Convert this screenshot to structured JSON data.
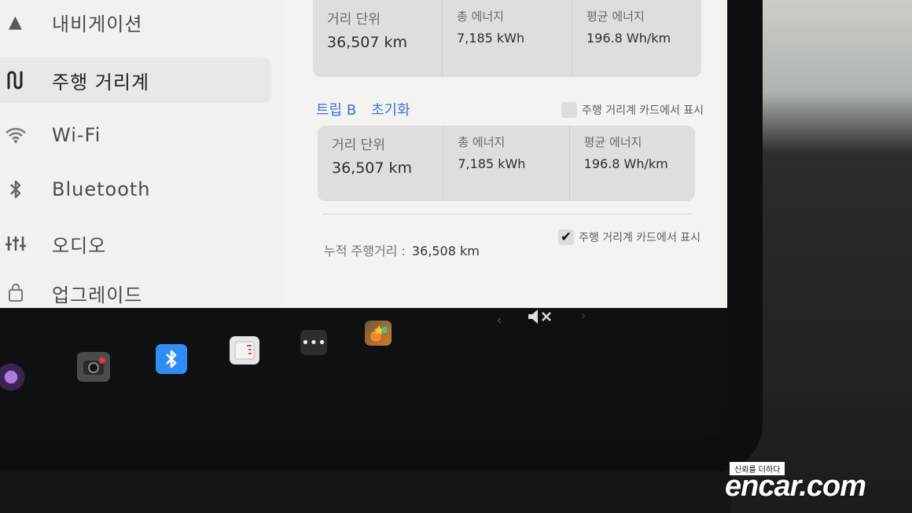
{
  "sidebar": {
    "items": [
      {
        "label": "내비게이션",
        "icon": "navigation-arrow-icon"
      },
      {
        "label": "주행 거리계",
        "icon": "odometer-path-icon",
        "active": true
      },
      {
        "label": "Wi-Fi",
        "icon": "wifi-icon"
      },
      {
        "label": "Bluetooth",
        "icon": "bluetooth-icon"
      },
      {
        "label": "오디오",
        "icon": "audio-sliders-icon"
      },
      {
        "label": "업그레이드",
        "icon": "shopping-bag-icon"
      }
    ]
  },
  "trip_a": {
    "distance_label": "거리 단위",
    "distance_value": "36,507 km",
    "energy_label": "총 에너지",
    "energy_value": "7,185 kWh",
    "avg_label": "평균 에너지",
    "avg_value": "196.8 Wh/km"
  },
  "trip_b": {
    "title": "트립 B",
    "reset_label": "초기화",
    "show_on_card_label": "주행 거리계 카드에서 표시",
    "show_on_card_checked": false,
    "distance_label": "거리 단위",
    "distance_value": "36,507 km",
    "energy_label": "총 에너지",
    "energy_value": "7,185 kWh",
    "avg_label": "평균 에너지",
    "avg_value": "196.8 Wh/km"
  },
  "odometer": {
    "label": "누적 주행거리 :",
    "value": "36,508 km",
    "show_on_card_label": "주행 거리계 카드에서 표시",
    "show_on_card_checked": true
  },
  "dock": {
    "icons": [
      "camera-icon",
      "dashcam-icon",
      "bluetooth-app-icon",
      "calendar-icon",
      "more-apps-icon",
      "toybox-icon"
    ],
    "volume_icon": "volume-muted-icon",
    "prev_icon": "chevron-left-icon",
    "next_icon": "chevron-right-icon",
    "bluetooth_color": "#2f8df5"
  },
  "watermark": {
    "tagline": "신뢰를 더하다",
    "brand": "encar.com"
  }
}
